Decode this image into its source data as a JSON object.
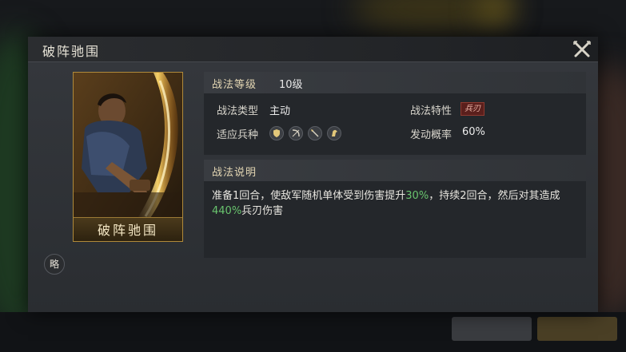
{
  "dialog": {
    "title": "破阵驰围",
    "card_name": "破阵驰围",
    "strategy_badge": "略"
  },
  "level": {
    "label": "战法等级",
    "value": "10级"
  },
  "attributes": {
    "type_label": "战法类型",
    "type_value": "主动",
    "trait_label": "战法特性",
    "trait_value": "兵刃",
    "units_label": "适应兵种",
    "units": [
      "shield-icon",
      "bow-icon",
      "spear-icon",
      "horse-icon"
    ],
    "chance_label": "发动概率",
    "chance_value": "60%"
  },
  "description": {
    "label": "战法说明",
    "part1": "准备1回合，使敌军随机单体受到伤害提升",
    "hl1": "30%",
    "part2": "，持续2回合，然后对其造成",
    "hl2": "440%",
    "part3": "兵刃伤害"
  },
  "colors": {
    "highlight": "#69c46e",
    "gold": "#b08a3a",
    "trait_red": "#5a1f1c"
  }
}
